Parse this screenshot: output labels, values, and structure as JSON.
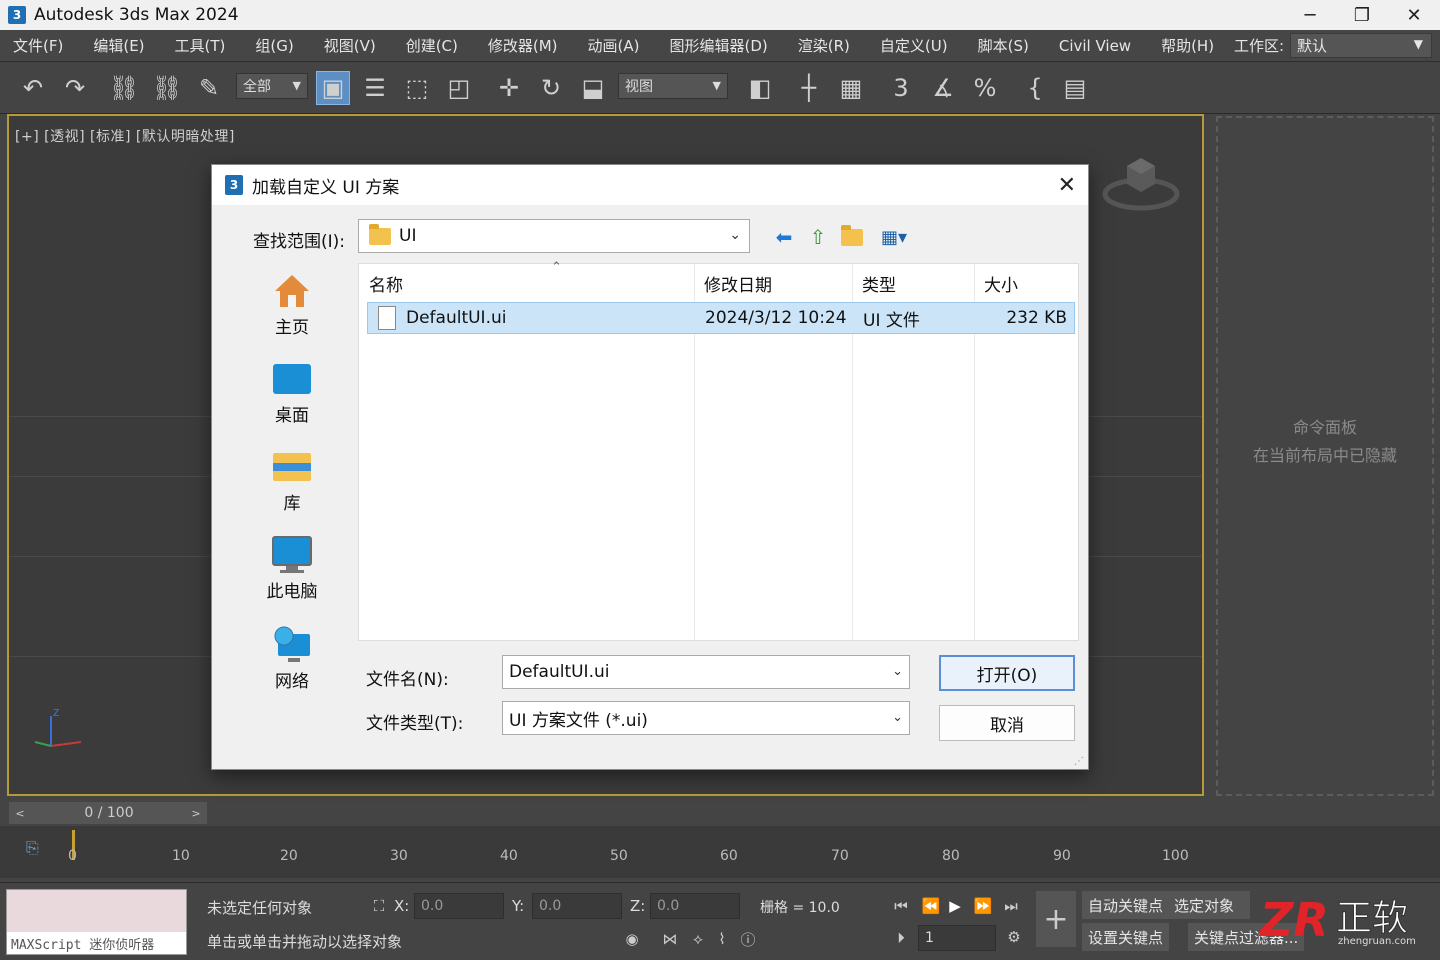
{
  "app": {
    "title": "Autodesk 3ds Max 2024",
    "logo": "3",
    "window_controls": [
      "─",
      "❐",
      "✕"
    ]
  },
  "menu": {
    "items": [
      "文件(F)",
      "编辑(E)",
      "工具(T)",
      "组(G)",
      "视图(V)",
      "创建(C)",
      "修改器(M)",
      "动画(A)",
      "图形编辑器(D)",
      "渲染(R)",
      "自定义(U)",
      "脚本(S)",
      "Civil View",
      "帮助(H)"
    ],
    "workspace_label": "工作区:",
    "workspace_value": "默认"
  },
  "toolbar": {
    "selection_filter": "全部",
    "reference_coord": "视图",
    "icons": [
      "undo-icon",
      "redo-icon",
      "link-icon",
      "unlink-icon",
      "bind-spacewarp-icon",
      "select-object-icon",
      "select-by-name-icon",
      "rect-selection-icon",
      "window-crossing-icon",
      "move-icon",
      "rotate-icon",
      "scale-icon",
      "mirror-icon",
      "align-icon",
      "layer-icon",
      "snap-3d-icon",
      "angle-snap-icon",
      "percent-snap-icon",
      "spinner-snap-icon",
      "render-setup-icon"
    ]
  },
  "viewport": {
    "label": "[+] [透视] [标准] [默认明暗处理]"
  },
  "command_panel": {
    "line1": "命令面板",
    "line2": "在当前布局中已隐藏"
  },
  "timeline": {
    "slider_text": "0 / 100",
    "prev": "<",
    "next": ">",
    "ticks": [
      "0",
      "10",
      "20",
      "30",
      "40",
      "50",
      "60",
      "70",
      "80",
      "90",
      "100"
    ]
  },
  "status": {
    "maxscript_label": "MAXScript 迷你侦听器",
    "selection_status": "未选定任何对象",
    "prompt": "单击或单击并拖动以选择对象",
    "x_label": "X:",
    "x_value": "0.0",
    "y_label": "Y:",
    "y_value": "0.0",
    "z_label": "Z:",
    "z_value": "0.0",
    "grid": "栅格 = 10.0",
    "auto_key": "自动关键点",
    "selected": "选定对象",
    "set_key": "设置关键点",
    "key_filter": "关键点过滤器...",
    "frame": "1"
  },
  "dialog": {
    "title": "加载自定义 UI 方案",
    "look_in_label": "查找范围(I):",
    "look_in_value": "UI",
    "places": [
      "主页",
      "桌面",
      "库",
      "此电脑",
      "网络"
    ],
    "columns": [
      "名称",
      "修改日期",
      "类型",
      "大小"
    ],
    "files": [
      {
        "name": "DefaultUI.ui",
        "date": "2024/3/12 10:24",
        "type": "UI 文件",
        "size": "232 KB"
      }
    ],
    "filename_label": "文件名(N):",
    "filename_value": "DefaultUI.ui",
    "filetype_label": "文件类型(T):",
    "filetype_value": "UI 方案文件 (*.ui)",
    "open_button": "打开(O)",
    "cancel_button": "取消"
  },
  "watermark": {
    "text": "ZR 正软",
    "url": "zhengruan.com"
  }
}
